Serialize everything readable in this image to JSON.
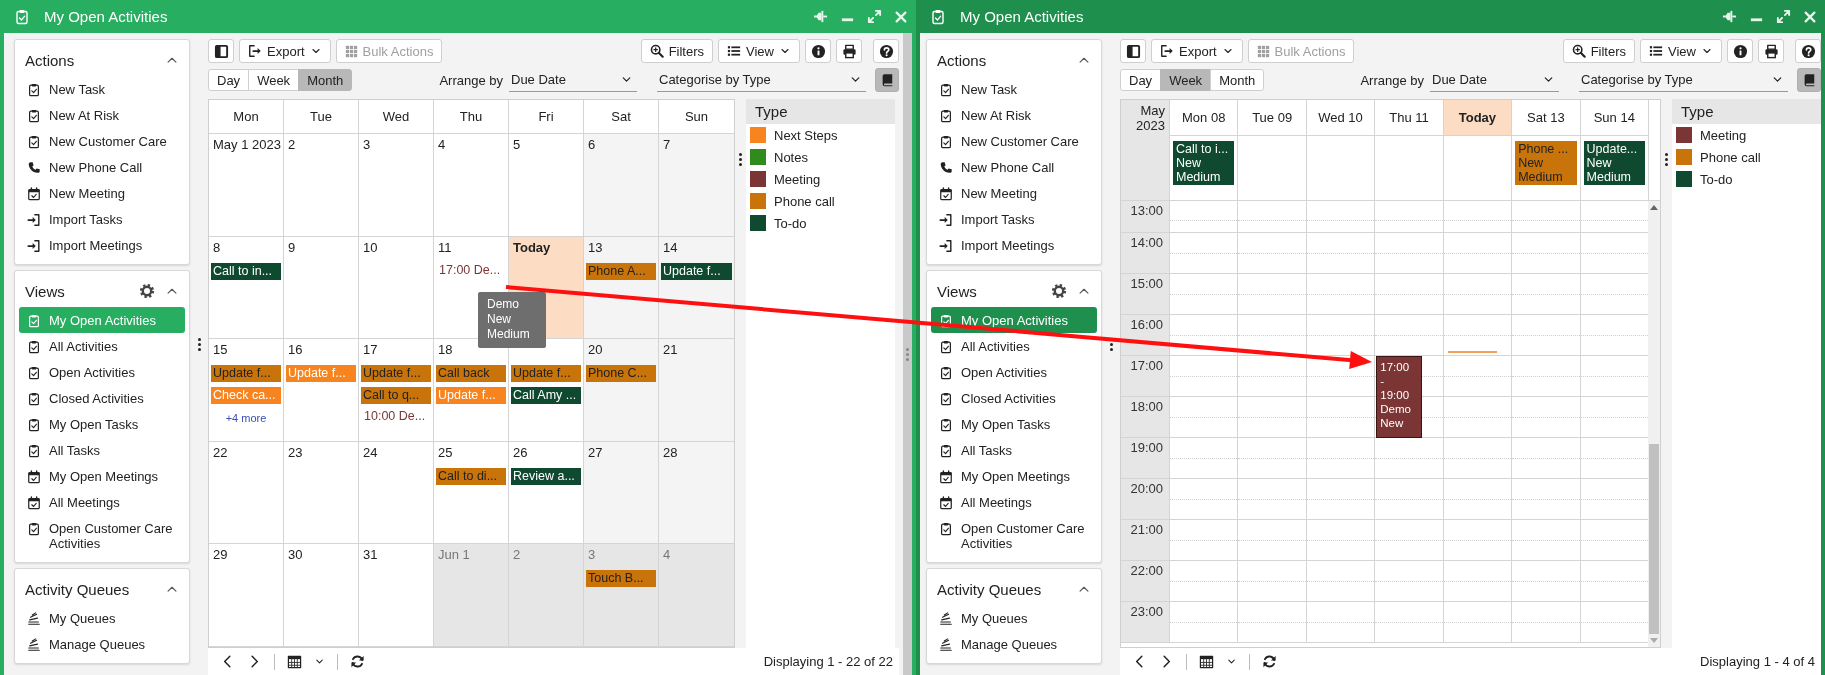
{
  "windows": [
    {
      "title": "My Open Activities",
      "focused": true,
      "sidebar": [
        {
          "title": "Actions",
          "settings": false,
          "items": [
            {
              "label": "New Task",
              "kind": "task"
            },
            {
              "label": "New At Risk",
              "kind": "task"
            },
            {
              "label": "New Customer Care",
              "kind": "task"
            },
            {
              "label": "New Phone Call",
              "kind": "call"
            },
            {
              "label": "New Meeting",
              "kind": "meeting"
            },
            {
              "label": "Import Tasks",
              "kind": "import"
            },
            {
              "label": "Import Meetings",
              "kind": "import"
            }
          ]
        },
        {
          "title": "Views",
          "settings": true,
          "items": [
            {
              "label": "My Open Activities",
              "kind": "task",
              "selected": true
            },
            {
              "label": "All Activities",
              "kind": "task",
              "selected": false
            },
            {
              "label": "Open Activities",
              "kind": "task",
              "selected": false
            },
            {
              "label": "Closed Activities",
              "kind": "task",
              "selected": false
            },
            {
              "label": "My Open Tasks",
              "kind": "task",
              "selected": false
            },
            {
              "label": "All Tasks",
              "kind": "task",
              "selected": false
            },
            {
              "label": "My Open Meetings",
              "kind": "meeting",
              "selected": false
            },
            {
              "label": "All Meetings",
              "kind": "meeting",
              "selected": false
            },
            {
              "label": "Open Customer Care Activities",
              "kind": "task",
              "selected": false
            }
          ]
        },
        {
          "title": "Activity Queues",
          "settings": false,
          "items": [
            {
              "label": "My Queues",
              "kind": "queue"
            },
            {
              "label": "Manage Queues",
              "kind": "queue"
            }
          ]
        }
      ],
      "toolbar": {
        "export": "Export",
        "bulk": "Bulk Actions",
        "bulk_disabled": true,
        "filters": "Filters",
        "view": "View"
      },
      "view_tabs": [
        {
          "label": "Day",
          "selected": false
        },
        {
          "label": "Week",
          "selected": false
        },
        {
          "label": "Month",
          "selected": true
        }
      ],
      "arrange": {
        "label": "Arrange by",
        "value": "Due Date"
      },
      "categorise": {
        "label": "Categorise by",
        "value": "Type"
      },
      "calendar": {
        "kind": "month",
        "headers": [
          "Mon",
          "Tue",
          "Wed",
          "Thu",
          "Fri",
          "Sat",
          "Sun"
        ],
        "weeks": [
          {
            "days": [
              {
                "day": "May 1 2023",
                "kind": "weekday"
              },
              {
                "day": "2",
                "kind": "weekday"
              },
              {
                "day": "3",
                "kind": "weekday"
              },
              {
                "day": "4",
                "kind": "weekday"
              },
              {
                "day": "5",
                "kind": "weekday"
              },
              {
                "day": "6",
                "kind": "weekend"
              },
              {
                "day": "7",
                "kind": "weekend"
              }
            ]
          },
          {
            "days": [
              {
                "day": "8",
                "kind": "weekday",
                "events": [
                  {
                    "kind": "bar",
                    "text": "Call to in...",
                    "color": "#0f4a30",
                    "dark_text": false
                  }
                ]
              },
              {
                "day": "9",
                "kind": "weekday"
              },
              {
                "day": "10",
                "kind": "weekday"
              },
              {
                "day": "11",
                "kind": "weekday",
                "events": [
                  {
                    "kind": "timed",
                    "text": "17:00 De...",
                    "color": "#7b3535"
                  }
                ]
              },
              {
                "day": "Today",
                "kind": "today"
              },
              {
                "day": "13",
                "kind": "weekend",
                "events": [
                  {
                    "kind": "bar",
                    "text": "Phone A...",
                    "color": "#c8740a",
                    "dark_text": true
                  }
                ]
              },
              {
                "day": "14",
                "kind": "weekend",
                "events": [
                  {
                    "kind": "bar",
                    "text": "Update f...",
                    "color": "#0f4a30",
                    "dark_text": false
                  }
                ]
              }
            ]
          },
          {
            "days": [
              {
                "day": "15",
                "kind": "weekday",
                "more": "+4 more",
                "events": [
                  {
                    "kind": "bar",
                    "text": "Update f...",
                    "color": "#c8740a",
                    "dark_text": true
                  },
                  {
                    "kind": "bar",
                    "text": "Check ca...",
                    "color": "#f7841f",
                    "dark_text": false
                  }
                ]
              },
              {
                "day": "16",
                "kind": "weekday",
                "events": [
                  {
                    "kind": "bar",
                    "text": "Update f...",
                    "color": "#f7841f",
                    "dark_text": false
                  }
                ]
              },
              {
                "day": "17",
                "kind": "weekday",
                "events": [
                  {
                    "kind": "bar",
                    "text": "Update f...",
                    "color": "#c8740a",
                    "dark_text": true
                  },
                  {
                    "kind": "bar",
                    "text": "Call to q...",
                    "color": "#c8740a",
                    "dark_text": true
                  },
                  {
                    "kind": "timed",
                    "text": "10:00 De...",
                    "color": "#7b3535"
                  }
                ]
              },
              {
                "day": "18",
                "kind": "weekday",
                "events": [
                  {
                    "kind": "bar",
                    "text": "Call back",
                    "color": "#c8740a",
                    "dark_text": true
                  },
                  {
                    "kind": "bar",
                    "text": "Update f...",
                    "color": "#f7841f",
                    "dark_text": false
                  }
                ]
              },
              {
                "kind": "weekday",
                "events": [
                  {
                    "kind": "bar",
                    "text": "Update f...",
                    "color": "#c8740a",
                    "dark_text": true
                  },
                  {
                    "kind": "bar",
                    "text": "Call Amy ...",
                    "color": "#0f4a30",
                    "dark_text": false
                  }
                ]
              },
              {
                "day": "20",
                "kind": "weekend",
                "events": [
                  {
                    "kind": "bar",
                    "text": "Phone C...",
                    "color": "#c8740a",
                    "dark_text": true
                  }
                ]
              },
              {
                "day": "21",
                "kind": "weekend"
              }
            ]
          },
          {
            "days": [
              {
                "day": "22",
                "kind": "weekday"
              },
              {
                "day": "23",
                "kind": "weekday"
              },
              {
                "day": "24",
                "kind": "weekday"
              },
              {
                "day": "25",
                "kind": "weekday",
                "events": [
                  {
                    "kind": "bar",
                    "text": "Call to di...",
                    "color": "#c8740a",
                    "dark_text": true
                  }
                ]
              },
              {
                "day": "26",
                "kind": "weekday",
                "events": [
                  {
                    "kind": "bar",
                    "text": "Review a...",
                    "color": "#0f4a30",
                    "dark_text": false
                  }
                ]
              },
              {
                "day": "27",
                "kind": "weekend"
              },
              {
                "day": "28",
                "kind": "weekend"
              }
            ]
          },
          {
            "days": [
              {
                "day": "29",
                "kind": "weekday"
              },
              {
                "day": "30",
                "kind": "weekday"
              },
              {
                "day": "31",
                "kind": "weekday"
              },
              {
                "day": "Jun 1",
                "kind": "other"
              },
              {
                "day": "2",
                "kind": "other"
              },
              {
                "day": "3",
                "kind": "other",
                "events": [
                  {
                    "kind": "bar",
                    "text": "Touch B...",
                    "color": "#c8740a",
                    "dark_text": true
                  }
                ]
              },
              {
                "day": "4",
                "kind": "other"
              }
            ]
          }
        ]
      },
      "legend": {
        "title": "Type",
        "items": [
          {
            "label": "Next Steps",
            "color": "#f7841f"
          },
          {
            "label": "Notes",
            "color": "#2e8b1c"
          },
          {
            "label": "Meeting",
            "color": "#7b3535"
          },
          {
            "label": "Phone call",
            "color": "#c8740a"
          },
          {
            "label": "To-do",
            "color": "#0f4a30"
          }
        ]
      },
      "status": "Displaying 1 - 22 of 22"
    },
    {
      "title": "My Open Activities",
      "focused": false,
      "sidebar": [
        {
          "title": "Actions",
          "settings": false,
          "items": [
            {
              "label": "New Task",
              "kind": "task"
            },
            {
              "label": "New At Risk",
              "kind": "task"
            },
            {
              "label": "New Customer Care",
              "kind": "task"
            },
            {
              "label": "New Phone Call",
              "kind": "call"
            },
            {
              "label": "New Meeting",
              "kind": "meeting"
            },
            {
              "label": "Import Tasks",
              "kind": "import"
            },
            {
              "label": "Import Meetings",
              "kind": "import"
            }
          ]
        },
        {
          "title": "Views",
          "settings": true,
          "items": [
            {
              "label": "My Open Activities",
              "kind": "task",
              "selected": true
            },
            {
              "label": "All Activities",
              "kind": "task",
              "selected": false
            },
            {
              "label": "Open Activities",
              "kind": "task",
              "selected": false
            },
            {
              "label": "Closed Activities",
              "kind": "task",
              "selected": false
            },
            {
              "label": "My Open Tasks",
              "kind": "task",
              "selected": false
            },
            {
              "label": "All Tasks",
              "kind": "task",
              "selected": false
            },
            {
              "label": "My Open Meetings",
              "kind": "meeting",
              "selected": false
            },
            {
              "label": "All Meetings",
              "kind": "meeting",
              "selected": false
            },
            {
              "label": "Open Customer Care Activities",
              "kind": "task",
              "selected": false
            }
          ]
        },
        {
          "title": "Activity Queues",
          "settings": false,
          "items": [
            {
              "label": "My Queues",
              "kind": "queue"
            },
            {
              "label": "Manage Queues",
              "kind": "queue"
            }
          ]
        }
      ],
      "toolbar": {
        "export": "Export",
        "bulk": "Bulk Actions",
        "bulk_disabled": true,
        "filters": "Filters",
        "view": "View"
      },
      "view_tabs": [
        {
          "label": "Day",
          "selected": false
        },
        {
          "label": "Week",
          "selected": true
        },
        {
          "label": "Month",
          "selected": false
        }
      ],
      "arrange": {
        "label": "Arrange by",
        "value": "Due Date"
      },
      "categorise": {
        "label": "Categorise by",
        "value": "Type"
      },
      "calendar": {
        "kind": "week",
        "corner": "May 2023",
        "columns": [
          {
            "label": "Mon 08",
            "today": false,
            "all_day": [
              {
                "lines": [
                  "Call to i...",
                  "New",
                  "Medium"
                ],
                "color": "#0f4a30",
                "dark_text": false
              }
            ]
          },
          {
            "label": "Tue 09",
            "today": false
          },
          {
            "label": "Wed 10",
            "today": false
          },
          {
            "label": "Thu 11",
            "today": false
          },
          {
            "label": "Today",
            "today": true
          },
          {
            "label": "Sat 13",
            "today": false,
            "all_day": [
              {
                "lines": [
                  "Phone ...",
                  "New",
                  "Medium"
                ],
                "color": "#c8740a",
                "dark_text": true
              }
            ]
          },
          {
            "label": "Sun 14",
            "today": false,
            "all_day": [
              {
                "lines": [
                  "Update...",
                  "New",
                  "Medium"
                ],
                "color": "#0f4a30",
                "dark_text": false
              }
            ]
          }
        ],
        "hours": [
          {
            "label": "13:00"
          },
          {
            "label": "14:00"
          },
          {
            "label": "15:00"
          },
          {
            "label": "16:00",
            "cells": [
              {
                "now_line": false
              },
              {
                "now_line": false
              },
              {
                "now_line": false
              },
              {
                "now_line": false
              },
              {
                "now_line": true
              },
              {
                "now_line": false
              },
              {
                "now_line": false
              }
            ]
          },
          {
            "label": "17:00",
            "cells": [
              {
                "now_line": false
              },
              {
                "now_line": false
              },
              {
                "now_line": false
              },
              {
                "now_line": false,
                "events": [
                  {
                    "lines": [
                      "17:00",
                      "-",
                      "19:00",
                      "Demo",
                      "New"
                    ],
                    "color": "#7b3535",
                    "dark_text": false
                  }
                ]
              },
              {
                "now_line": false
              },
              {
                "now_line": false
              },
              {
                "now_line": false
              }
            ]
          },
          {
            "label": "18:00"
          },
          {
            "label": "19:00"
          },
          {
            "label": "20:00"
          },
          {
            "label": "21:00"
          },
          {
            "label": "22:00"
          },
          {
            "label": "23:00"
          }
        ]
      },
      "legend": {
        "title": "Type",
        "items": [
          {
            "label": "Meeting",
            "color": "#7b3535"
          },
          {
            "label": "Phone call",
            "color": "#c8740a"
          },
          {
            "label": "To-do",
            "color": "#0f4a30"
          }
        ]
      },
      "status": "Displaying 1 - 4 of 4"
    }
  ],
  "tooltip": {
    "lines": [
      "Demo",
      "New",
      "Medium"
    ]
  }
}
